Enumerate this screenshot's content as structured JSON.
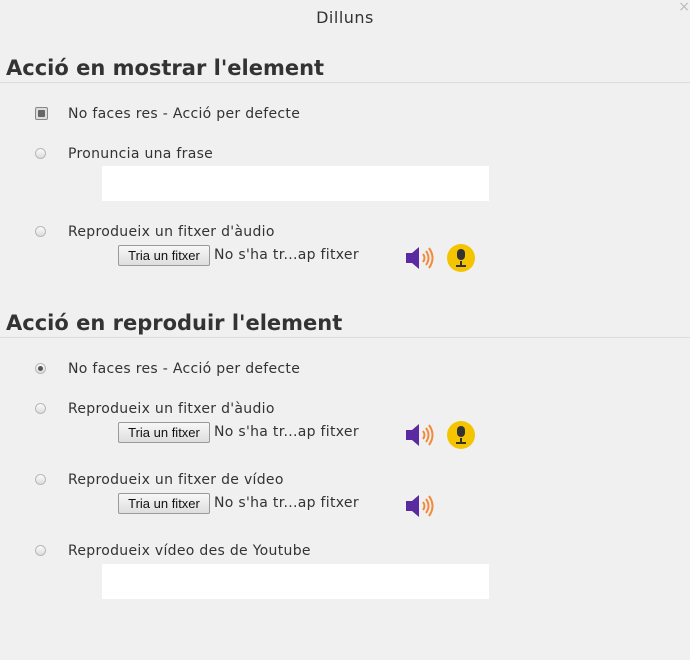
{
  "dialog": {
    "title": "Dilluns",
    "close_icon": "×"
  },
  "section1": {
    "title": "Acció en mostrar l'element",
    "options": [
      {
        "label": "No faces res - Acció per defecte",
        "selected": true
      },
      {
        "label": "Pronuncia una frase",
        "selected": false
      },
      {
        "label": "Reprodueix un fitxer d'àudio",
        "selected": false
      }
    ],
    "phrase_input": {
      "value": "",
      "placeholder": ""
    },
    "audio_file": {
      "button_label": "Tria un fitxer",
      "status": "No s'ha tr...ap fitxer"
    }
  },
  "section2": {
    "title": "Acció en reproduir l'element",
    "options": [
      {
        "label": "No faces res - Acció per defecte",
        "selected": true
      },
      {
        "label": "Reprodueix un fitxer d'àudio",
        "selected": false
      },
      {
        "label": "Reprodueix un fitxer de vídeo",
        "selected": false
      },
      {
        "label": "Reprodueix vídeo des de Youtube",
        "selected": false
      }
    ],
    "audio_file": {
      "button_label": "Tria un fitxer",
      "status": "No s'ha tr...ap fitxer"
    },
    "video_file": {
      "button_label": "Tria un fitxer",
      "status": "No s'ha tr...ap fitxer"
    },
    "youtube_input": {
      "value": "",
      "placeholder": ""
    }
  },
  "icons": {
    "speaker": "speaker-icon",
    "mic": "microphone-icon"
  },
  "colors": {
    "background": "#f0f0f0",
    "speaker_purple": "#5b2aa0",
    "speaker_waves": "#f28a3c",
    "mic_yellow": "#f5c400"
  }
}
